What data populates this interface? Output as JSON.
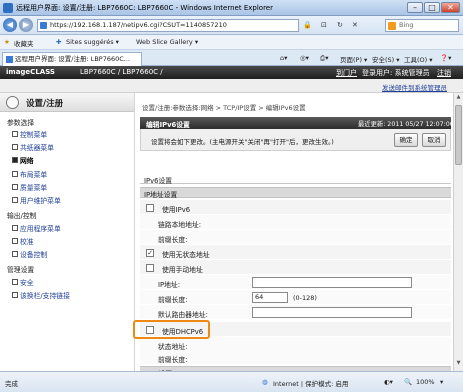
{
  "window": {
    "title": "远程用户界面: 设置/注册: LBP7660C: LBP7660C - Windows Internet Explorer",
    "min": "–",
    "max": "□",
    "close": "✕"
  },
  "browser": {
    "url": "https://192.168.1.187/netipv6.cgi?CSUT=1140857210",
    "search_placeholder": "Bing",
    "favorites_label": "收藏夹",
    "fav_links": [
      "Sites suggérés ▾",
      "Web Slice Gallery ▾"
    ],
    "tab_title": "远程用户界面: 设置/注册: LBP7660C...",
    "tools": [
      "页面(P) ▾",
      "安全(S) ▾",
      "工具(O) ▾",
      "❓▾"
    ]
  },
  "app": {
    "brand": "imageCLASS",
    "model": "LBP7660C / LBP7660C /",
    "portal_link": "到门户",
    "login_user": "登录用户: 系统管理员",
    "logout": "注销",
    "sysmgr_link": "发送邮件到系统管理员"
  },
  "sidebar": {
    "header": "设置/注册",
    "groups": [
      {
        "label": "参数选择",
        "items": [
          "控制菜单",
          "共纸器菜单",
          "网络",
          "布局菜单",
          "质量菜单",
          "用户维护菜单"
        ]
      },
      {
        "label": "输出/控制",
        "items": [
          "应用程序菜单",
          "校准",
          "设备控制"
        ]
      },
      {
        "label": "管理设置",
        "items": [
          "安全",
          "该换栏/支持链接"
        ]
      }
    ],
    "selected": "网络"
  },
  "main": {
    "breadcrumb": "设置/注册:参数选择:网络 > TCP/IP设置 > 编辑IPv6设置",
    "page_title": "编辑IPv6设置",
    "last_updated": "最近更新: 2011 05/27 12:07:00",
    "notice": "设置将会如下更改。(主电源开关\"关闭\"再\"打开\"后，更改生效。)",
    "ok_button": "确定",
    "cancel_button": "取消",
    "section_ipv6": "IPv6设置",
    "section_addr": "IP地址设置",
    "use_ipv6": "使用IPv6",
    "link_local_addr": "链路本地地址:",
    "prefix_len_label": "前缀长度:",
    "use_stateless": "使用无状态地址",
    "use_manual": "使用手动地址",
    "ip_address_label": "IP地址:",
    "ip_address_value": "",
    "prefix_len2_label": "前缀长度:",
    "prefix_len_value": "64",
    "prefix_len_hint": "(0-128)",
    "default_router_label": "默认路由器地址:",
    "default_router_value": "",
    "use_dhcpv6": "使用DHCPv6",
    "stateful_addr": "状态地址:",
    "prefix_len3_label": "前缀长度:",
    "section_dns": "DNS设置",
    "checks": {
      "use_ipv6": false,
      "use_stateless": true,
      "use_manual": false,
      "use_dhcpv6": false
    }
  },
  "status": {
    "left": "完成",
    "zone": "Internet | 保护模式: 启用",
    "zoom": "100%"
  },
  "colors": {
    "highlight": "#ee8a13",
    "link": "#1f3f99",
    "header_dark": "#2c2c2c"
  }
}
